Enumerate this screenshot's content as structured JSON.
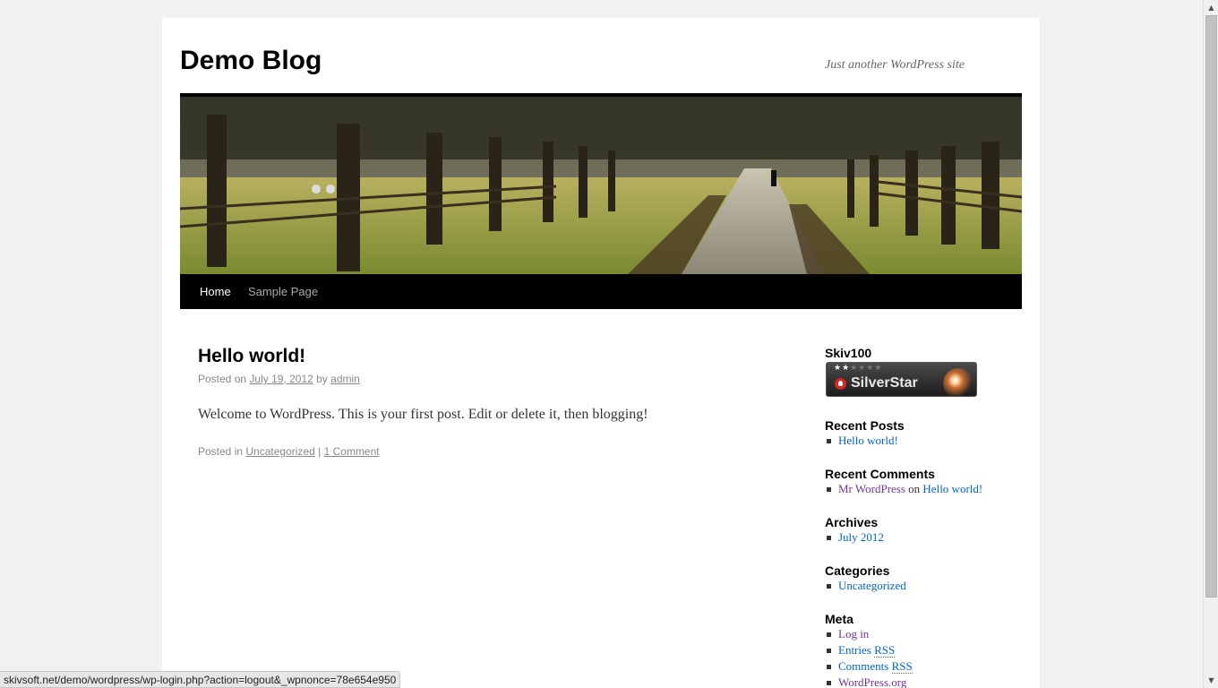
{
  "site": {
    "title": "Demo Blog",
    "description": "Just another WordPress site"
  },
  "nav": {
    "items": [
      {
        "label": "Home",
        "current": true
      },
      {
        "label": "Sample Page",
        "current": false
      }
    ]
  },
  "post": {
    "title": "Hello world!",
    "meta_prefix": "Posted on",
    "date": "July 19, 2012",
    "meta_by": "by",
    "author": "admin",
    "content": "Welcome to WordPress. This is your first post. Edit or delete it, then blogging!",
    "utility_prefix": "Posted in",
    "category": "Uncategorized",
    "separator": "|",
    "comments": "1 Comment"
  },
  "sidebar": {
    "badge_widget": {
      "title": "Skiv100",
      "badge_label": "SilverStar",
      "stars_filled": 2,
      "stars_total": 6
    },
    "recent_posts": {
      "title": "Recent Posts",
      "items": [
        "Hello world!"
      ]
    },
    "recent_comments": {
      "title": "Recent Comments",
      "author": "Mr WordPress",
      "on": "on",
      "post": "Hello world!"
    },
    "archives": {
      "title": "Archives",
      "items": [
        "July 2012"
      ]
    },
    "categories": {
      "title": "Categories",
      "items": [
        "Uncategorized"
      ]
    },
    "meta": {
      "title": "Meta",
      "login": "Log in",
      "entries_prefix": "Entries",
      "entries_rss": "RSS",
      "comments_prefix": "Comments",
      "comments_rss": "RSS",
      "wordpress": "WordPress.org"
    }
  },
  "status_bar": {
    "url": "skivsoft.net/demo/wordpress/wp-login.php?action=logout&_wpnonce=78e654e950"
  },
  "colors": {
    "link": "#0066cc",
    "visited_link": "#743399",
    "nav_background": "#000000",
    "page_background": "#f1f1f1"
  }
}
